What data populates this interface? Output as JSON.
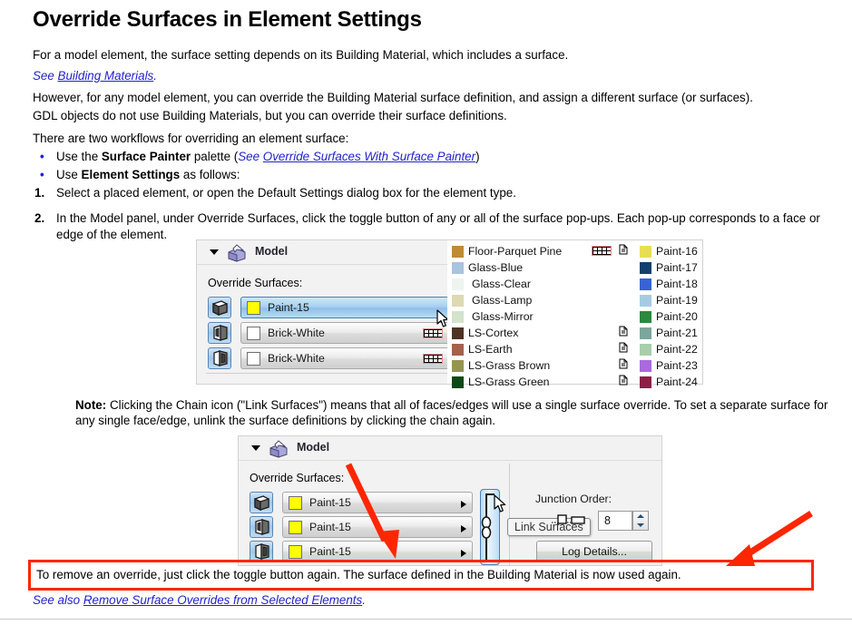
{
  "document": {
    "title": "Override Surfaces in Element Settings",
    "paragraphs": [
      "For a model element, the surface setting depends on its Building Material, which includes a surface.",
      "However, for any model element, you can override the Building Material surface definition, and assign a different surface (or surfaces).",
      "GDL objects do not use Building Materials, but you can override their surface definitions.",
      "There are two workflows for overriding an element surface:"
    ],
    "see_prefix": "See ",
    "see_link": "Building Materials",
    "see_suffix": ".",
    "bullets": [
      {
        "pre": "Use the ",
        "bold": "Surface Painter",
        "mid": " palette (",
        "see": "See ",
        "link": "Override Surfaces With Surface Painter",
        "post": ")"
      },
      {
        "pre": "Use ",
        "bold": "Element Settings",
        "mid": " as follows:",
        "see": "",
        "link": "",
        "post": ""
      }
    ],
    "steps": [
      {
        "num": "1.",
        "text": "Select a placed element, or open the Default Settings dialog box for the element type."
      },
      {
        "num": "2.",
        "text": "In the Model panel, under Override Surfaces, click the toggle button of any or all of the surface pop-ups. Each pop-up corresponds to a face or edge of the element."
      }
    ],
    "note": {
      "label": "Note:",
      "text": " Clicking the Chain icon (\"Link Surfaces\") means that all of faces/edges will use a single surface override. To set a separate surface for any single face/edge, unlink the surface definitions by clicking the chain again."
    },
    "callout": "To remove an override, just click the toggle button again. The surface defined in the Building Material is now used again.",
    "see_also_prefix": "See also ",
    "see_also_link": "Remove Surface Overrides from Selected Elements",
    "see_also_suffix": "."
  },
  "colors": {
    "link": "#2222cc",
    "annotation_red": "#ff2600",
    "selected_blue": "#a9d0f0",
    "toggle_blue": "#9ec7ea"
  },
  "screenshot_one": {
    "panel_title": "Model",
    "panel_icon": "model-cube-icon",
    "override_label": "Override Surfaces:",
    "rows": [
      {
        "toggle_icon": "surface-face-icon",
        "swatch": "#ffff00",
        "name": "Paint-15",
        "selected": true,
        "hatch": false,
        "doc": false,
        "cursor": true
      },
      {
        "toggle_icon": "surface-side-icon",
        "swatch": "#ffffff",
        "name": "Brick-White",
        "selected": false,
        "hatch": true,
        "doc": true,
        "cursor": false
      },
      {
        "toggle_icon": "surface-edge-icon",
        "swatch": "#ffffff",
        "name": "Brick-White",
        "selected": false,
        "hatch": true,
        "doc": true,
        "cursor": false
      }
    ],
    "popup_column_one": [
      {
        "swatch": "#bf8b33",
        "name": "Floor-Parquet Pine",
        "hatch": true,
        "doc": true
      },
      {
        "swatch": "#a8c4de",
        "name": "Glass-Blue",
        "hatch": false,
        "doc": false
      },
      {
        "swatch": "#eef5f1",
        "name": "Glass-Clear",
        "hatch": false,
        "doc": false
      },
      {
        "swatch": "#ddd9b0",
        "name": "Glass-Lamp",
        "hatch": false,
        "doc": false
      },
      {
        "swatch": "#d4e3cb",
        "name": "Glass-Mirror",
        "hatch": false,
        "doc": false
      },
      {
        "swatch": "#4d3324",
        "name": "LS-Cortex",
        "hatch": false,
        "doc": true
      },
      {
        "swatch": "#a5614a",
        "name": "LS-Earth",
        "hatch": false,
        "doc": true
      },
      {
        "swatch": "#94954f",
        "name": "LS-Grass Brown",
        "hatch": false,
        "doc": true
      },
      {
        "swatch": "#0d4a16",
        "name": "LS-Grass Green",
        "hatch": false,
        "doc": true
      }
    ],
    "popup_column_two": [
      {
        "swatch": "#e8de52",
        "name": "Paint-16"
      },
      {
        "swatch": "#123f6e",
        "name": "Paint-17"
      },
      {
        "swatch": "#3763d4",
        "name": "Paint-18"
      },
      {
        "swatch": "#a5cbe3",
        "name": "Paint-19"
      },
      {
        "swatch": "#2b8a3e",
        "name": "Paint-20"
      },
      {
        "swatch": "#79a79c",
        "name": "Paint-21"
      },
      {
        "swatch": "#a9ceab",
        "name": "Paint-22"
      },
      {
        "swatch": "#a96ae0",
        "name": "Paint-23"
      },
      {
        "swatch": "#8c1f46",
        "name": "Paint-24"
      }
    ]
  },
  "screenshot_two": {
    "panel_title": "Model",
    "panel_icon": "model-cube-icon",
    "override_label": "Override Surfaces:",
    "rows": [
      {
        "toggle_icon": "surface-face-icon",
        "swatch": "#ffff00",
        "name": "Paint-15"
      },
      {
        "toggle_icon": "surface-side-icon",
        "swatch": "#ffff00",
        "name": "Paint-15"
      },
      {
        "toggle_icon": "surface-edge-icon",
        "swatch": "#ffff00",
        "name": "Paint-15"
      }
    ],
    "chain_icon": "chain-link-icon",
    "tooltip": "Link Surfaces",
    "junction_label": "Junction Order:",
    "junction_value": "8",
    "junction_icon": "junction-order-icon",
    "log_button": "Log Details..."
  }
}
